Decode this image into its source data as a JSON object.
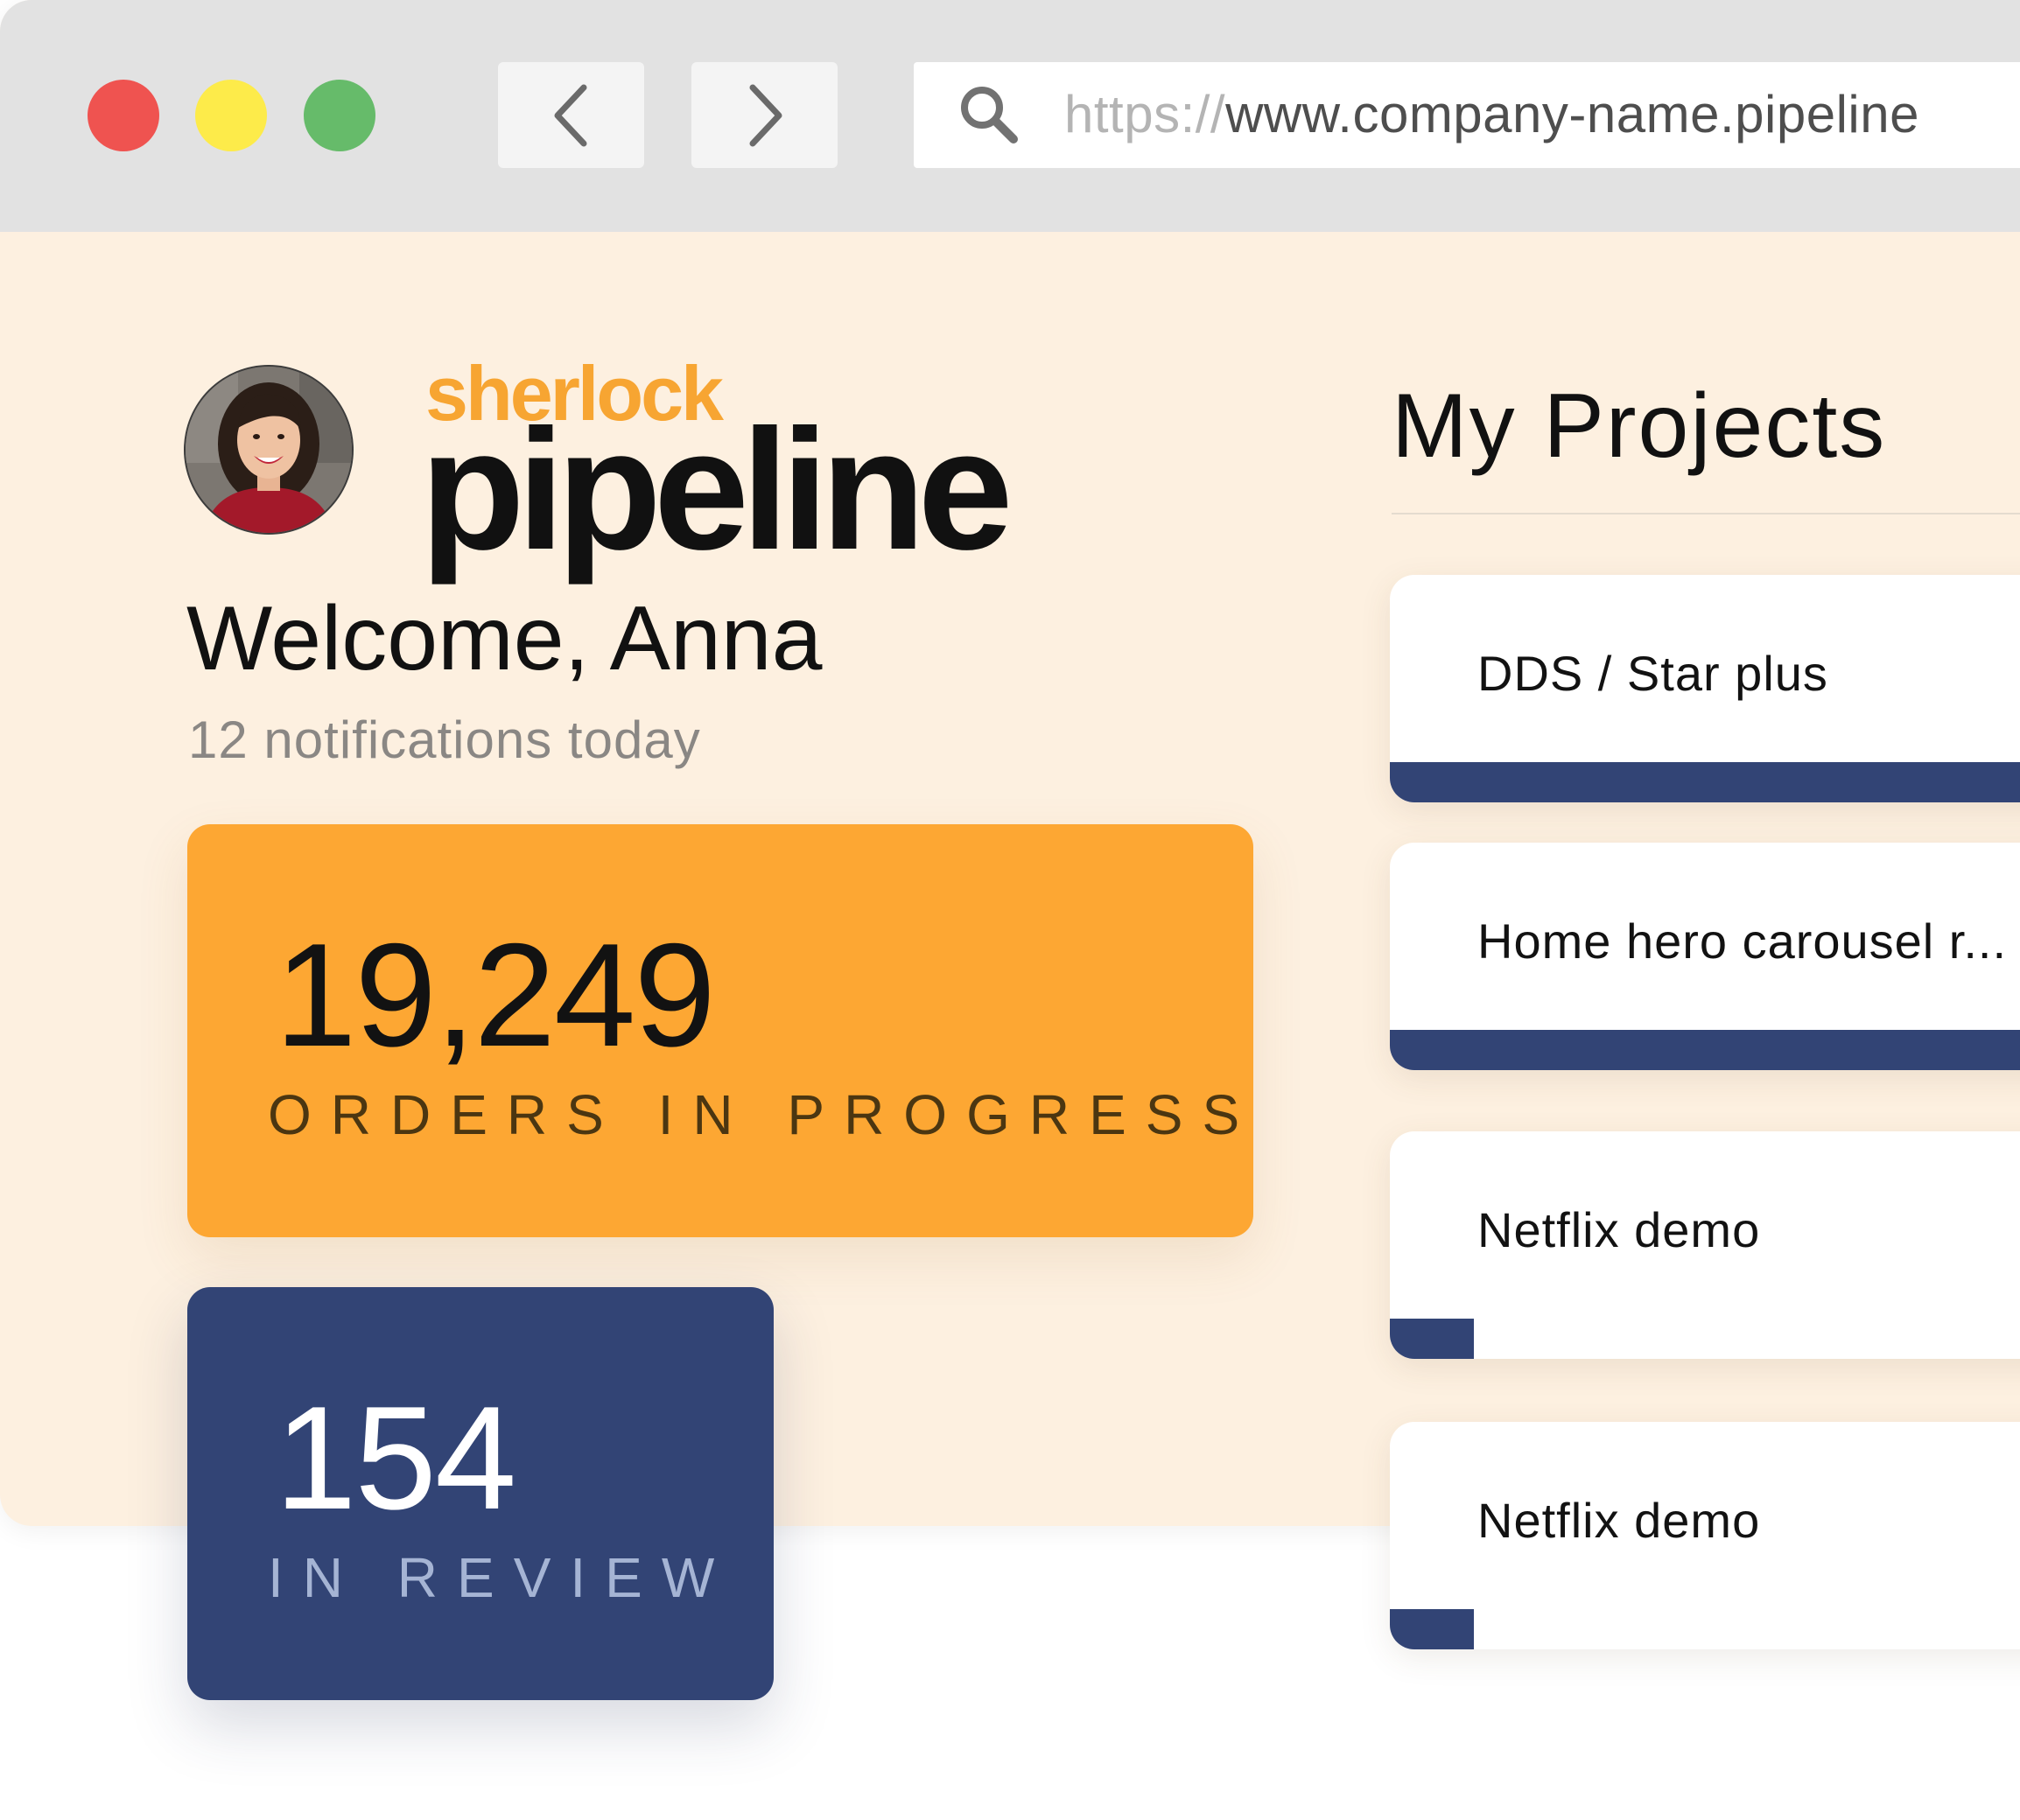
{
  "browser": {
    "url_protocol": "https://",
    "url_host": "www.company-name.pipeline"
  },
  "colors": {
    "accent_orange": "#fda733",
    "accent_navy": "#324475",
    "page_background": "#fdf0e0",
    "traffic_red": "#ef5350",
    "traffic_yellow": "#fdeb4a",
    "traffic_green": "#66bb6a"
  },
  "brand": {
    "logo_top": "sherlock",
    "logo_main": "pipeline"
  },
  "user": {
    "welcome": "Welcome, Anna",
    "notifications": "12 notifications today"
  },
  "stats": [
    {
      "value": "19,249",
      "label": "ORDERS IN PROGRESS"
    },
    {
      "value": "154",
      "label": "IN REVIEW"
    }
  ],
  "projects": {
    "title": "My Projects",
    "items": [
      {
        "name": "DDS / Star plus",
        "progress": 1.0
      },
      {
        "name": "Home hero carousel r...",
        "progress": 1.0
      },
      {
        "name": "Netflix demo",
        "progress": 0.12
      },
      {
        "name": "Netflix demo",
        "progress": 0.12
      }
    ]
  }
}
